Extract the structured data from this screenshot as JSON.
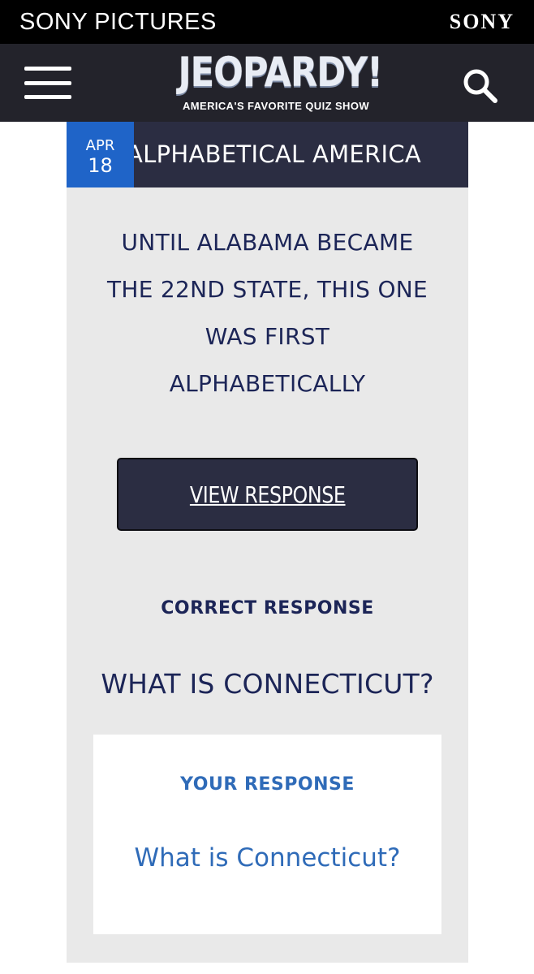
{
  "header": {
    "sony_pictures_label": "SONY PICTURES",
    "sony_label": "SONY"
  },
  "nav": {
    "logo_text": "JEOPARDY!",
    "tagline": "AMERICA'S FAVORITE QUIZ SHOW",
    "menu_icon": "hamburger-menu-icon",
    "search_icon": "search-icon"
  },
  "clue": {
    "date_month": "APR",
    "date_day": "18",
    "category": "ALPHABETICAL AMERICA",
    "text_lines": [
      "UNTIL ALABAMA BECAME",
      "THE 22ND STATE, THIS ONE",
      "WAS FIRST",
      "ALPHABETICALLY"
    ],
    "view_response_label": "VIEW RESPONSE",
    "correct_response_heading": "CORRECT RESPONSE",
    "correct_response": "WHAT IS CONNECTICUT?",
    "your_response_heading": "YOUR RESPONSE",
    "your_response": "What is Connecticut?"
  },
  "colors": {
    "top_bar": "#000000",
    "nav_bar": "#23232b",
    "category_bar": "#2b2d42",
    "date_badge": "#1f64c8",
    "card_bg": "#e9e9e9",
    "navy_text": "#1c2557",
    "blue_text": "#2f6bb8"
  }
}
